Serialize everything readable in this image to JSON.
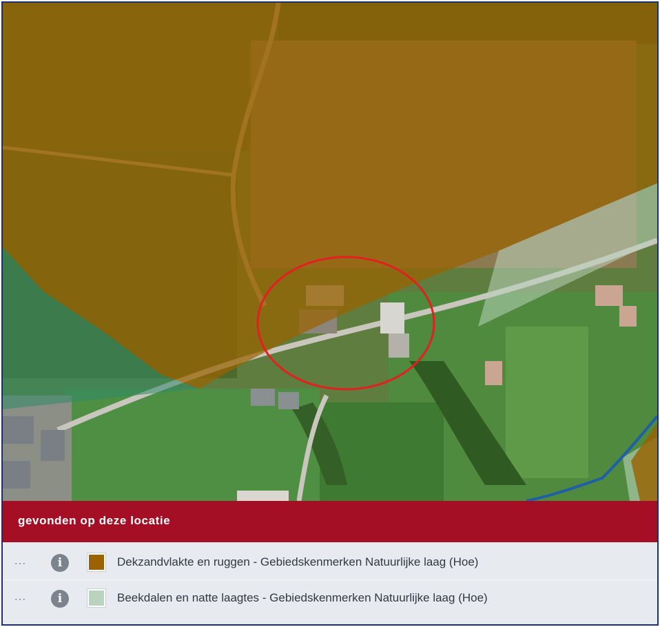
{
  "panel": {
    "title": "gevonden op deze locatie"
  },
  "results": [
    {
      "more_label": "…",
      "info_icon": "info-icon",
      "swatch_color": "#9a6200",
      "label": "Dekzandvlakte en ruggen - Gebiedskenmerken Natuurlijke laag (Hoe)"
    },
    {
      "more_label": "…",
      "info_icon": "info-icon",
      "swatch_color": "#b9d3bc",
      "label": "Beekdalen en natte laagtes - Gebiedskenmerken Natuurlijke laag (Hoe)"
    }
  ],
  "map": {
    "base": "aerial-photo",
    "marker": "red-ellipse",
    "overlay_colors": {
      "dekzandvlakte": "#9a6200",
      "beekdalen": "#b9d3bc",
      "watercourse": "#1f5fa8",
      "marker": "#e3201f"
    }
  }
}
